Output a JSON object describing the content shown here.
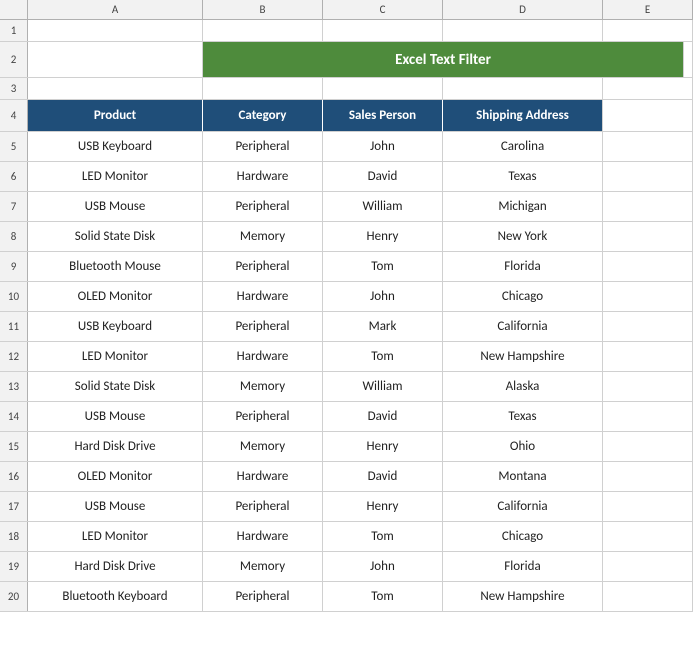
{
  "title": "Excel Text Filter",
  "columns": {
    "letters": [
      "A",
      "B",
      "C",
      "D",
      "E"
    ],
    "headers": [
      "Product",
      "Category",
      "Sales Person",
      "Shipping Address"
    ]
  },
  "rows": [
    {
      "num": 1,
      "data": []
    },
    {
      "num": 2,
      "data": [
        "title"
      ]
    },
    {
      "num": 3,
      "data": []
    },
    {
      "num": 4,
      "data": [
        "Product",
        "Category",
        "Sales Person",
        "Shipping Address"
      ]
    },
    {
      "num": 5,
      "data": [
        "USB Keyboard",
        "Peripheral",
        "John",
        "Carolina"
      ]
    },
    {
      "num": 6,
      "data": [
        "LED Monitor",
        "Hardware",
        "David",
        "Texas"
      ]
    },
    {
      "num": 7,
      "data": [
        "USB Mouse",
        "Peripheral",
        "William",
        "Michigan"
      ]
    },
    {
      "num": 8,
      "data": [
        "Solid State Disk",
        "Memory",
        "Henry",
        "New York"
      ]
    },
    {
      "num": 9,
      "data": [
        "Bluetooth Mouse",
        "Peripheral",
        "Tom",
        "Florida"
      ]
    },
    {
      "num": 10,
      "data": [
        "OLED Monitor",
        "Hardware",
        "John",
        "Chicago"
      ]
    },
    {
      "num": 11,
      "data": [
        "USB Keyboard",
        "Peripheral",
        "Mark",
        "California"
      ]
    },
    {
      "num": 12,
      "data": [
        "LED Monitor",
        "Hardware",
        "Tom",
        "New Hampshire"
      ]
    },
    {
      "num": 13,
      "data": [
        "Solid State Disk",
        "Memory",
        "William",
        "Alaska"
      ]
    },
    {
      "num": 14,
      "data": [
        "USB Mouse",
        "Peripheral",
        "David",
        "Texas"
      ]
    },
    {
      "num": 15,
      "data": [
        "Hard Disk Drive",
        "Memory",
        "Henry",
        "Ohio"
      ]
    },
    {
      "num": 16,
      "data": [
        "OLED Monitor",
        "Hardware",
        "David",
        "Montana"
      ]
    },
    {
      "num": 17,
      "data": [
        "USB Mouse",
        "Peripheral",
        "Henry",
        "California"
      ]
    },
    {
      "num": 18,
      "data": [
        "LED Monitor",
        "Hardware",
        "Tom",
        "Chicago"
      ]
    },
    {
      "num": 19,
      "data": [
        "Hard Disk Drive",
        "Memory",
        "John",
        "Florida"
      ]
    },
    {
      "num": 20,
      "data": [
        "Bluetooth Keyboard",
        "Peripheral",
        "Tom",
        "New Hampshire"
      ]
    }
  ]
}
